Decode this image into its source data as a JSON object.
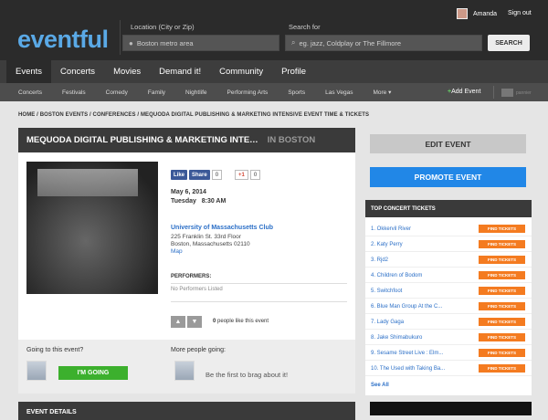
{
  "header": {
    "logo": "eventful",
    "location_label": "Location (City or Zip)",
    "location_value": "Boston metro area",
    "search_label": "Search for",
    "search_placeholder": "eg. jazz, Coldplay or The Fillmore",
    "search_button": "SEARCH",
    "user_name": "Amanda",
    "signout": "Sign out"
  },
  "main_nav": [
    {
      "label": "Events",
      "active": true
    },
    {
      "label": "Concerts"
    },
    {
      "label": "Movies"
    },
    {
      "label": "Demand it!"
    },
    {
      "label": "Community"
    },
    {
      "label": "Profile"
    }
  ],
  "sub_nav": [
    "Concerts",
    "Festivals",
    "Comedy",
    "Family",
    "Nightlife",
    "Performing Arts",
    "Sports",
    "Las Vegas",
    "More"
  ],
  "sub_nav_more_arrow": "▾",
  "add_event_plus": "+",
  "add_event": "Add Event",
  "pm_label": "pannier",
  "breadcrumb": "HOME / BOSTON EVENTS / CONFERENCES / MEQUODA DIGITAL PUBLISHING & MARKETING INTENSIVE EVENT TIME & TICKETS",
  "event": {
    "title": "MEQUODA DIGITAL PUBLISHING & MARKETING INTE…",
    "city": "IN BOSTON",
    "social": {
      "like": "Like",
      "share": "Share",
      "fb_count": "0",
      "gplus": "+1",
      "gplus_count": "0"
    },
    "date": "May 6, 2014",
    "day": "Tuesday",
    "time": "8:30 AM",
    "venue": "University of Massachusetts Club",
    "address1": "225 Franklin St. 33rd Floor",
    "address2": "Boston, Massachusetts 02110",
    "map": "Map",
    "performers_label": "PERFORMERS:",
    "performers_value": "No Performers Listed",
    "like_count": "0",
    "like_text": "people like this event"
  },
  "going": {
    "label": "Going to this event?",
    "button": "I'M GOING",
    "more_label": "More people going:",
    "brag": "Be the first to brag about it!"
  },
  "details_title": "EVENT DETAILS",
  "sidebar": {
    "edit": "EDIT EVENT",
    "promote": "PROMOTE EVENT",
    "tickets_title": "TOP CONCERT TICKETS",
    "see_all": "See All",
    "find_tickets": "FIND TICKETS",
    "tickets": [
      "1. Okkervil River",
      "2. Katy Perry",
      "3. Rjd2",
      "4. Children of Bodom",
      "5. Switchfoot",
      "6. Blue Man Group At the C...",
      "7. Lady Gaga",
      "8. Jake Shimabukuro",
      "9. Sesame Street Live : Elm...",
      "10. The Used with Taking Ba..."
    ]
  },
  "colors": {
    "logo": "#5aa9e6",
    "promote": "#2187e7",
    "going": "#3cb02d",
    "find_tickets": "#f47b20"
  }
}
